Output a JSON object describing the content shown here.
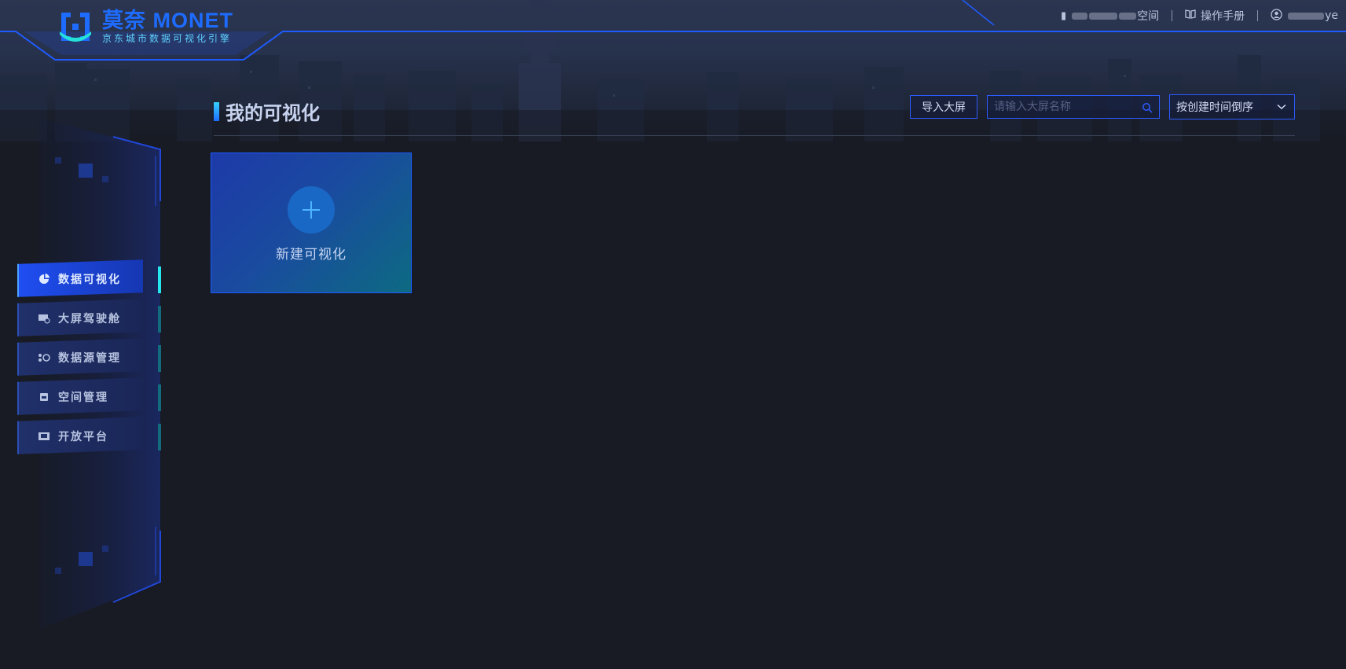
{
  "header": {
    "logo_title": "莫奈 MONET",
    "logo_subtitle": "京东城市数据可视化引擎",
    "workspace_suffix": "空间",
    "manual_label": "操作手册",
    "user_suffix": "ye",
    "icons": [
      "workspace-icon",
      "book-icon",
      "user-icon"
    ]
  },
  "main": {
    "title": "我的可视化",
    "import_button": "导入大屏",
    "search_placeholder": "请输入大屏名称",
    "sort_value": "按创建时间倒序",
    "create_card_label": "新建可视化"
  },
  "sidebar": {
    "items": [
      {
        "label": "数据可视化",
        "icon": "pie-chart-icon",
        "active": true
      },
      {
        "label": "大屏驾驶舱",
        "icon": "monitor-icon",
        "active": false
      },
      {
        "label": "数据源管理",
        "icon": "datasource-icon",
        "active": false
      },
      {
        "label": "空间管理",
        "icon": "space-icon",
        "active": false
      },
      {
        "label": "开放平台",
        "icon": "platform-icon",
        "active": false
      }
    ]
  },
  "colors": {
    "background": "#181b24",
    "accent": "#1e6cff",
    "accent_cyan": "#25e6ec",
    "border": "#2c5bff"
  }
}
